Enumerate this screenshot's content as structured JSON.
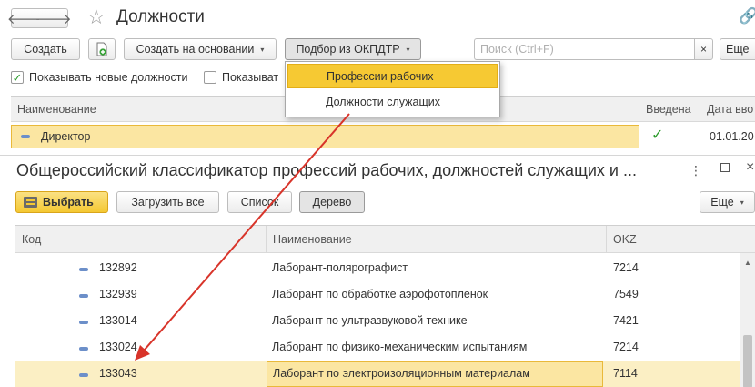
{
  "window": {
    "title": "Должности",
    "nav_back": "🡐",
    "nav_forward": "🡒",
    "star": "☆",
    "link": "🔗"
  },
  "toolbar": {
    "create_label": "Создать",
    "create_copy_icon": "document-plus-icon",
    "create_basis_label": "Создать на основании",
    "okpdtr_label": "Подбор из ОКПДТР",
    "caret": "▾",
    "more_label": "Еще",
    "clear": "×"
  },
  "search": {
    "placeholder": "Поиск (Ctrl+F)",
    "value": ""
  },
  "checkboxes": {
    "new_positions_label": "Показывать новые должности",
    "new_positions_checked": true,
    "other_label": "Показыват",
    "other_checked": false,
    "check_mark": "✓"
  },
  "positions_table": {
    "columns": [
      "Наименование",
      "Введена",
      "Дата вво"
    ],
    "rows": [
      {
        "name": "Директор",
        "introduced_mark": "✓",
        "date": "01.01.20"
      }
    ]
  },
  "popup_menu": {
    "items": [
      "Профессии рабочих",
      "Должности служащих"
    ],
    "highlighted": 0
  },
  "classifier_form": {
    "title": "Общероссийский классификатор профессий рабочих, должностей служащих и ...",
    "menu_icon": "⋮",
    "close_icon": "×",
    "select_label": "Выбрать",
    "load_all_label": "Загрузить все",
    "list_label": "Список",
    "tree_label": "Дерево",
    "more_label": "Еще",
    "caret": "▾",
    "columns": [
      "Код",
      "Наименование",
      "OKZ"
    ],
    "rows": [
      {
        "code": "132892",
        "name": "Лаборант-полярографист",
        "okz": "7214"
      },
      {
        "code": "132939",
        "name": "Лаборант по обработке аэрофотопленок",
        "okz": "7549"
      },
      {
        "code": "133014",
        "name": "Лаборант по ультразвуковой технике",
        "okz": "7421"
      },
      {
        "code": "133024",
        "name": "Лаборант по физико-механическим испытаниям",
        "okz": "7214"
      },
      {
        "code": "133043",
        "name": "Лаборант по электроизоляционным материалам",
        "okz": "7114"
      }
    ],
    "selected_row": 4,
    "scroll_up": "▲"
  },
  "colors": {
    "accent_yellow": "#f6c933",
    "selection_yellow": "#fbe6a2",
    "arrow_red": "#d8342a",
    "check_green": "#2a9b2a"
  }
}
